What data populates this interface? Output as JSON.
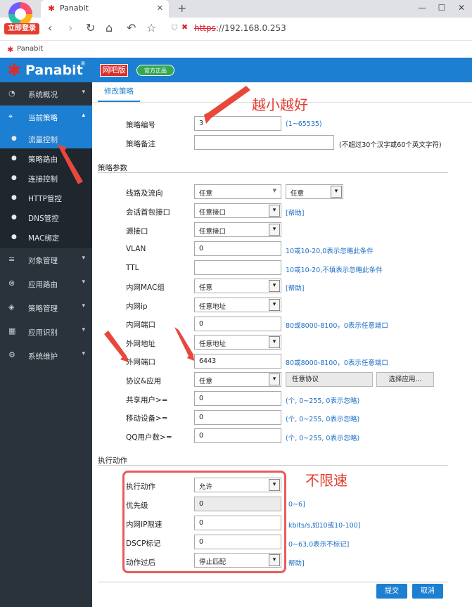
{
  "browser": {
    "login_badge": "立即登录",
    "tab_title": "Panabit",
    "tab_close": "✕",
    "new_tab": "+",
    "url_scheme": "https",
    "url_rest": "://192.168.0.253",
    "bookmark": "Panabit",
    "window_buttons": [
      "—",
      "☐",
      "✕"
    ]
  },
  "header": {
    "brand": "Panabit",
    "reg": "®",
    "netbar_badge": "网吧版",
    "genuine_badge": "官方正品"
  },
  "sidebar": {
    "items": [
      {
        "label": "系统概况",
        "icon": "dashboard-icon"
      },
      {
        "label": "当前策略",
        "icon": "location-icon"
      },
      {
        "label": "对象管理",
        "icon": "database-icon"
      },
      {
        "label": "应用路由",
        "icon": "route-icon"
      },
      {
        "label": "策略管理",
        "icon": "layers-icon"
      },
      {
        "label": "应用识别",
        "icon": "apps-icon"
      },
      {
        "label": "系统维护",
        "icon": "gear-icon"
      }
    ],
    "subitems": [
      "流量控制",
      "策略路由",
      "连接控制",
      "HTTP管控",
      "DNS管控",
      "MAC绑定"
    ]
  },
  "main": {
    "tab": "修改策略",
    "policy_no_label": "策略编号",
    "policy_no_value": "3",
    "policy_no_hint": "(1~65535)",
    "policy_note_label": "策略备注",
    "policy_note_value": "",
    "policy_note_hint": "(不超过30个汉字或60个英文字符)",
    "params_title": "策略参数",
    "line_label": "线路及流向",
    "line_value": "任意",
    "line_dir_value": "任意",
    "session_label": "会话首包接口",
    "session_value": "任意接口",
    "help": "[帮助]",
    "src_if_label": "源接口",
    "src_if_value": "任意接口",
    "vlan_label": "VLAN",
    "vlan_value": "0",
    "vlan_hint": "10或10-20,0表示忽略此条件",
    "ttl_label": "TTL",
    "ttl_value": "",
    "ttl_hint": "10或10-20,不填表示忽略此条件",
    "mac_label": "内网MAC组",
    "mac_value": "任意",
    "inner_ip_label": "内网ip",
    "inner_ip_value": "任意地址",
    "inner_port_label": "内网端口",
    "inner_port_value": "0",
    "port_hint": "80或8000-8100，0表示任意端口",
    "outer_addr_label": "外网地址",
    "outer_addr_value": "任意地址",
    "outer_port_label": "外网端口",
    "outer_port_value": "6443",
    "proto_label": "协议&应用",
    "proto_value": "任意",
    "proto_any_button": "任意协议",
    "select_app_button": "选择应用...",
    "shared_label": "共享用户>=",
    "shared_value": "0",
    "mobile_label": "移动设备>=",
    "mobile_value": "0",
    "qq_label": "QQ用户数>=",
    "qq_value": "0",
    "count_hint": "(个, 0~255, 0表示忽略)",
    "action_title": "执行动作",
    "action_label": "执行动作",
    "action_value": "允许",
    "priority_label": "优先级",
    "priority_value": "0",
    "priority_hint": "0~6]",
    "rate_label": "内网IP限速",
    "rate_value": "0",
    "rate_hint": "kbits/s,如10或10-100]",
    "dscp_label": "DSCP标记",
    "dscp_value": "0",
    "dscp_hint": "0~63,0表示不标记]",
    "after_label": "动作过后",
    "after_value": "停止匹配",
    "after_hint": "帮助]",
    "submit": "提交",
    "cancel": "取消"
  },
  "annotations": {
    "smaller_better": "越小越好",
    "no_limit": "不限速"
  },
  "colors": {
    "header_blue": "#1d7fd1",
    "sidebar_dark": "#2a333c",
    "annotation_red": "#e23b2e",
    "hint_blue": "#1d6fc4"
  }
}
